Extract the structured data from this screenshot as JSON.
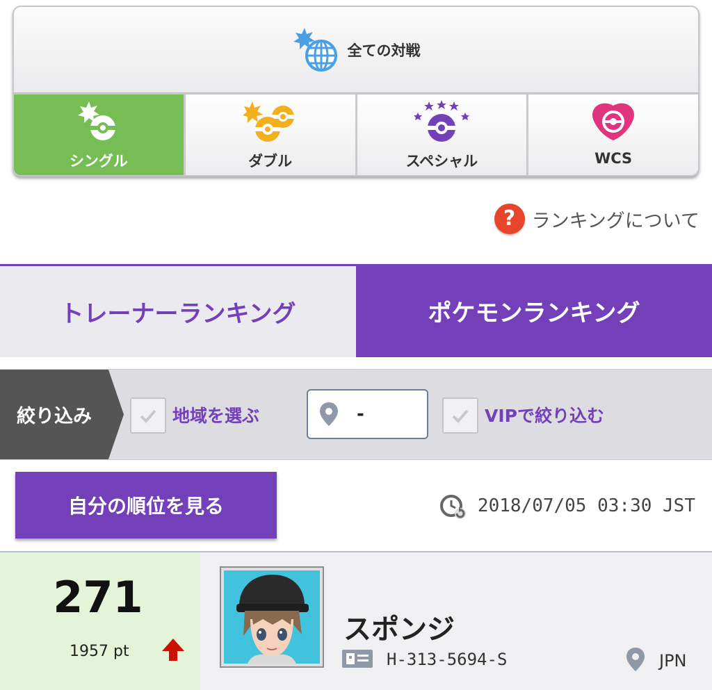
{
  "battles": {
    "all_label": "全ての対戦",
    "modes": [
      {
        "label": "シングル",
        "active": true
      },
      {
        "label": "ダブル",
        "active": false
      },
      {
        "label": "スペシャル",
        "active": false
      },
      {
        "label": "WCS",
        "active": false
      }
    ]
  },
  "about": {
    "label": "ランキングについて",
    "icon": "question-icon"
  },
  "tabs": [
    {
      "label": "トレーナーランキング",
      "active": false
    },
    {
      "label": "ポケモンランキング",
      "active": true
    }
  ],
  "filter": {
    "tag_label": "絞り込み",
    "region_label": "地域を選ぶ",
    "region_value": "-",
    "vip_label": "VIPで絞り込む"
  },
  "self_rank_button": "自分の順位を見る",
  "updated": "2018/07/05 03:30 JST",
  "entry": {
    "rank": "271",
    "points": "1957 pt",
    "trend": "up",
    "name": "スポンジ",
    "trainer_id": "H-313-5694-S",
    "country": "JPN"
  },
  "colors": {
    "accent_purple": "#7440b9",
    "active_green": "#76bd54",
    "rank_bg": "#e3f4d9",
    "trend_up": "#cc1100"
  }
}
